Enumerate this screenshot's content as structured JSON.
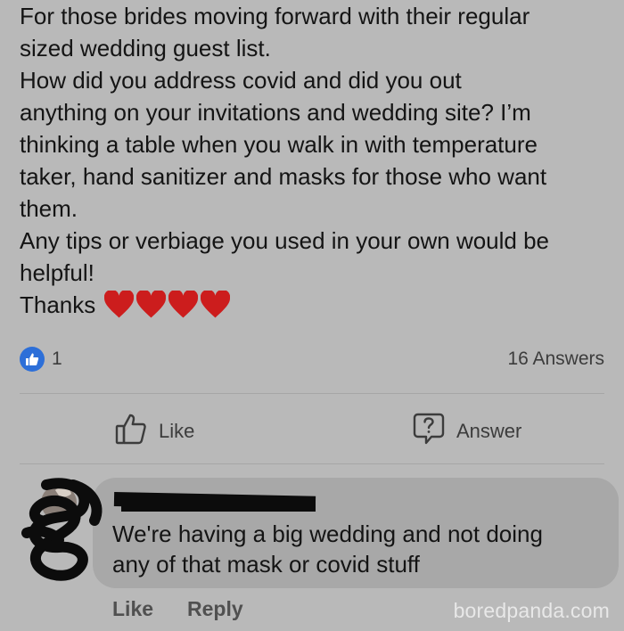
{
  "post": {
    "lines": [
      "For those brides moving forward with their regular",
      "sized wedding guest list.",
      "How did you address covid and did you out",
      "anything on your invitations and wedding site? I’m",
      "thinking a table when you walk in with temperature",
      "taker, hand sanitizer and masks for those who want",
      "them.",
      "Any tips or verbiage you used in your own would be",
      "helpful!"
    ],
    "thanks": "Thanks",
    "emoji": "heart-emoji x4"
  },
  "reactions": {
    "like_count": "1",
    "answers": "16 Answers",
    "like_color": "#2d6fd8"
  },
  "actions": {
    "like_label": "Like",
    "answer_label": "Answer"
  },
  "comment": {
    "lines": [
      "We're having a big wedding and not doing",
      "any of that mask or covid stuff"
    ],
    "like_label": "Like",
    "reply_label": "Reply"
  },
  "watermark": "boredpanda.com"
}
